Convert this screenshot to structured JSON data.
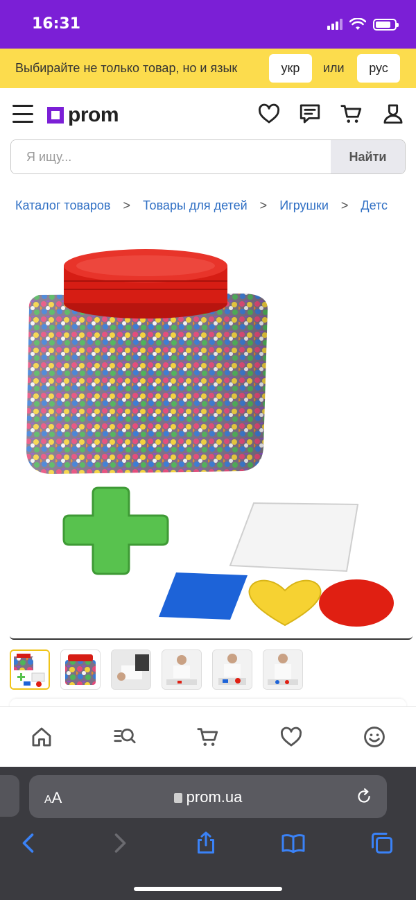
{
  "status_bar": {
    "time": "16:31"
  },
  "lang_banner": {
    "text": "Выбирайте не только товар, но и язык",
    "ukr_label": "укр",
    "or_label": "или",
    "rus_label": "рус"
  },
  "header": {
    "logo": "prom"
  },
  "search": {
    "placeholder": "Я ищу...",
    "value": "",
    "button_label": "Найти"
  },
  "breadcrumbs": [
    "Каталог товаров",
    "Товары для детей",
    "Игрушки",
    "Детс"
  ],
  "gallery": {
    "thumbnails": 6,
    "active_thumbnail": 1
  },
  "browser": {
    "url": "prom.ua",
    "text_size_label_small": "A",
    "text_size_label_large": "A"
  },
  "colors": {
    "accent": "#7b1fd6",
    "banner": "#fcdc4d",
    "link": "#2f6fc4",
    "safari_toolbar": "#3b3b40",
    "safari_icon": "#3a82f7"
  },
  "icons": {
    "header": [
      "menu-icon",
      "heart-icon",
      "chat-icon",
      "cart-icon",
      "user-icon"
    ],
    "bottom_nav": [
      "home-icon",
      "catalog-search-icon",
      "cart-icon",
      "heart-icon",
      "smiley-icon"
    ],
    "browser": [
      "back-icon",
      "forward-icon",
      "share-icon",
      "bookmarks-icon",
      "tabs-icon",
      "reload-icon",
      "lock-icon"
    ]
  }
}
